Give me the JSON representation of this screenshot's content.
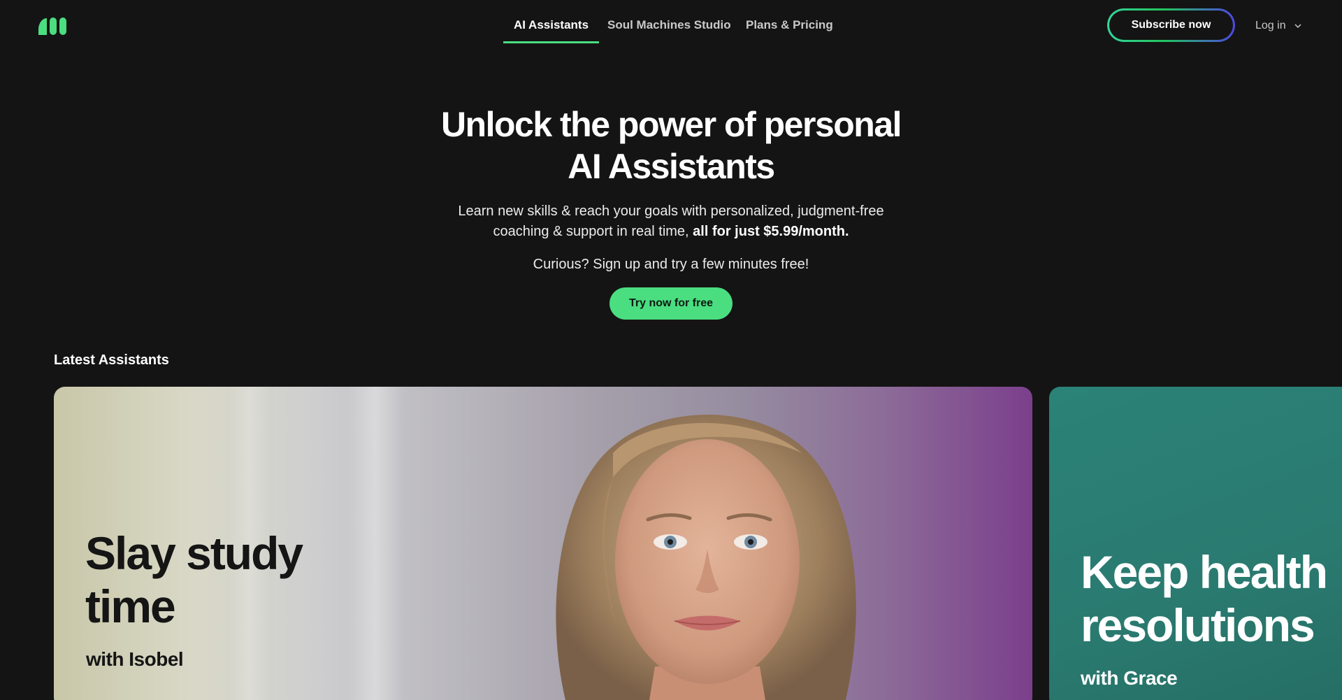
{
  "header": {
    "nav": [
      {
        "label": "AI Assistants",
        "active": true
      },
      {
        "label": "Soul Machines Studio",
        "active": false
      },
      {
        "label": "Plans & Pricing",
        "active": false
      }
    ],
    "subscribe_label": "Subscribe now",
    "login_label": "Log in",
    "logo_icon": "soul-machines-logo-icon"
  },
  "hero": {
    "title_line1": "Unlock the power of personal",
    "title_line2": "AI Assistants",
    "subtitle_line1": "Learn new skills & reach your goals with personalized, judgment-free",
    "subtitle_line2": "coaching & support in real time, ",
    "subtitle_strong": "all for just $5.99/month.",
    "curious": "Curious? Sign up and try a few minutes free!",
    "cta_label": "Try now for free"
  },
  "latest": {
    "title": "Latest Assistants",
    "cards": [
      {
        "headline_line1": "Slay study",
        "headline_line2": "time",
        "with": "with Isobel"
      },
      {
        "headline_line1": "Keep health",
        "headline_line2": "resolutions",
        "with": "with Grace"
      }
    ]
  },
  "colors": {
    "accent": "#4ade80",
    "background": "#141414",
    "grace_card": "#2b8277"
  }
}
